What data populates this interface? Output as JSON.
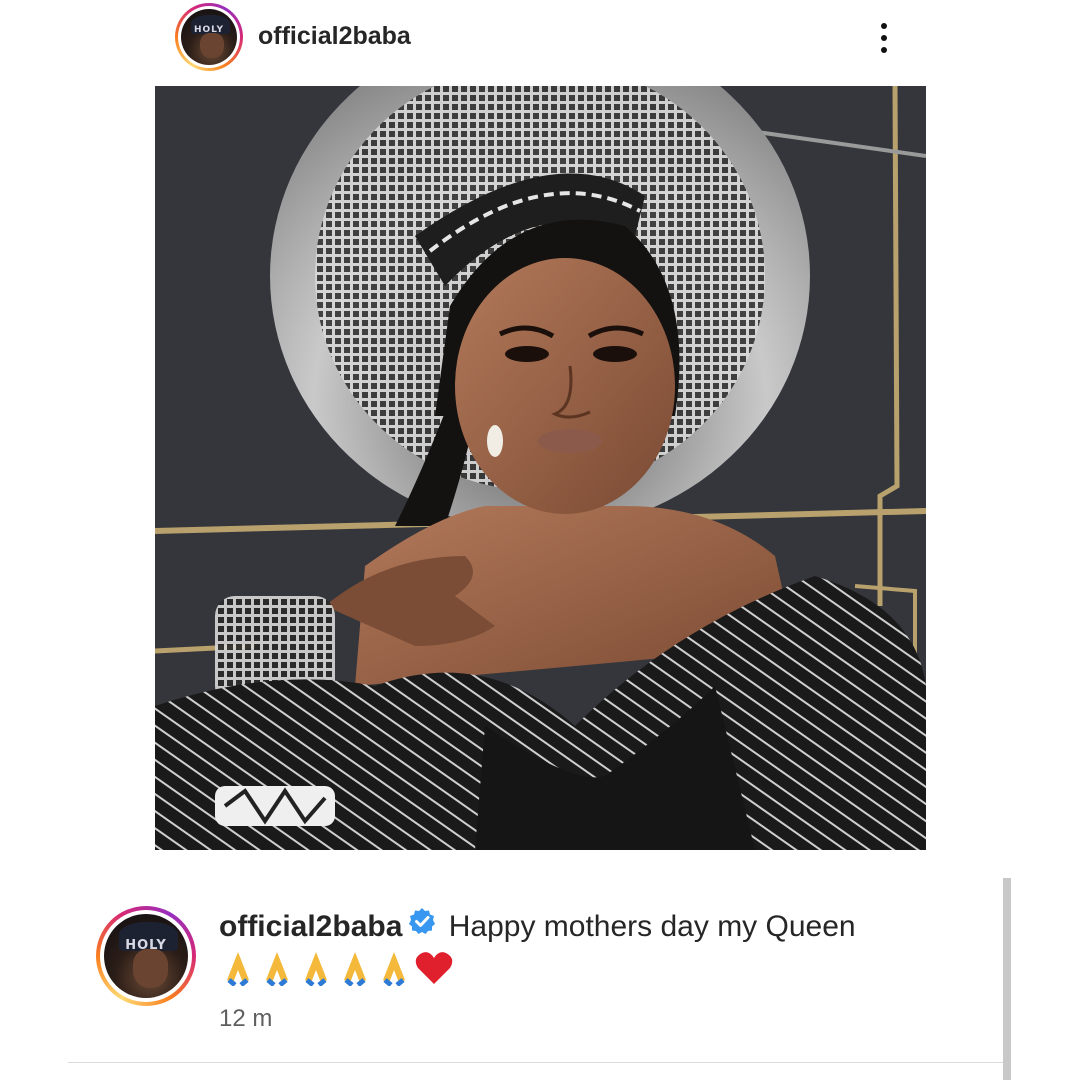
{
  "post": {
    "username": "official2baba",
    "avatar_cap_text": "HOLY",
    "more_icon": "more-vertical-icon",
    "photo_alt": "Woman in traditional headdress",
    "caption": {
      "username": "official2baba",
      "verified_icon": "verified-badge-icon",
      "text": "Happy mothers day my Queen",
      "emojis": [
        "🙏",
        "🙏",
        "🙏",
        "🙏",
        "🙏",
        "❤️"
      ]
    },
    "timestamp": "12 m"
  },
  "colors": {
    "verified_blue": "#3897f0",
    "heart_red": "#e0202d",
    "text": "#262626",
    "muted": "#5f5f5f"
  }
}
